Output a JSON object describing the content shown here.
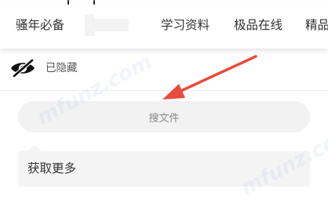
{
  "nav": {
    "items": [
      {
        "label": "骚年必备"
      },
      {
        "label": "学习资料"
      },
      {
        "label": "极品在线"
      },
      {
        "label": "精品"
      }
    ]
  },
  "visibility": {
    "icon": "eye-slash-icon",
    "label": "已隐藏"
  },
  "search": {
    "label": "搜文件"
  },
  "more": {
    "label": "获取更多"
  },
  "watermark": {
    "text": "mfunz.com"
  },
  "colors": {
    "annotation_arrow": "#e74c3c",
    "pill_background": "#f2f2f2",
    "card_background": "#f4f4f4"
  }
}
